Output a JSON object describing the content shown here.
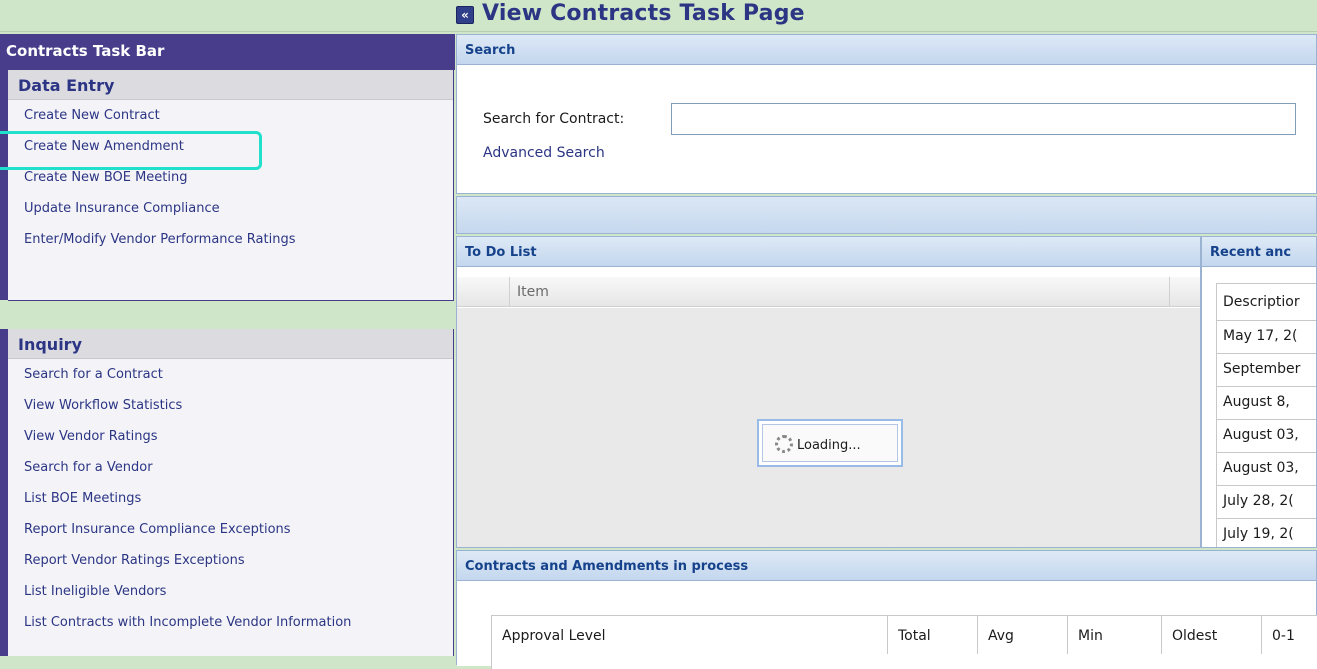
{
  "page": {
    "title": "View Contracts Task Page",
    "collapse_glyph": "«"
  },
  "sidebar": {
    "header": "Contracts Task Bar",
    "data_entry": {
      "title": "Data Entry",
      "items": [
        "Create New Contract",
        "Create New Amendment",
        "Create New BOE Meeting",
        "Update Insurance Compliance",
        "Enter/Modify Vendor Performance Ratings"
      ]
    },
    "inquiry": {
      "title": "Inquiry",
      "items": [
        "Search for a Contract",
        "View Workflow Statistics",
        "View Vendor Ratings",
        "Search for a Vendor",
        "List BOE Meetings",
        "Report Insurance Compliance Exceptions",
        "Report Vendor Ratings Exceptions",
        "List Ineligible Vendors",
        "List Contracts with Incomplete Vendor Information"
      ]
    }
  },
  "search": {
    "header": "Search",
    "label": "Search for Contract:",
    "value": "",
    "advanced_link": "Advanced Search"
  },
  "todo": {
    "header": "To Do List",
    "column_item": "Item",
    "loading_text": "Loading..."
  },
  "recent": {
    "header": "Recent anc",
    "column": "Descriptior",
    "rows": [
      "May 17, 2(",
      "September",
      "August 8,",
      "August 03,",
      "August 03,",
      "July 28, 2(",
      "July 19, 2("
    ]
  },
  "in_process": {
    "header": "Contracts and Amendments in process",
    "columns": [
      "Approval Level",
      "Total",
      "Avg",
      "Min",
      "Oldest",
      "0-1"
    ]
  },
  "colors": {
    "sidebar_accent": "#483d8b",
    "title_blue": "#2b3584",
    "highlight": "#20e0cc",
    "background": "#cfe6c9"
  }
}
